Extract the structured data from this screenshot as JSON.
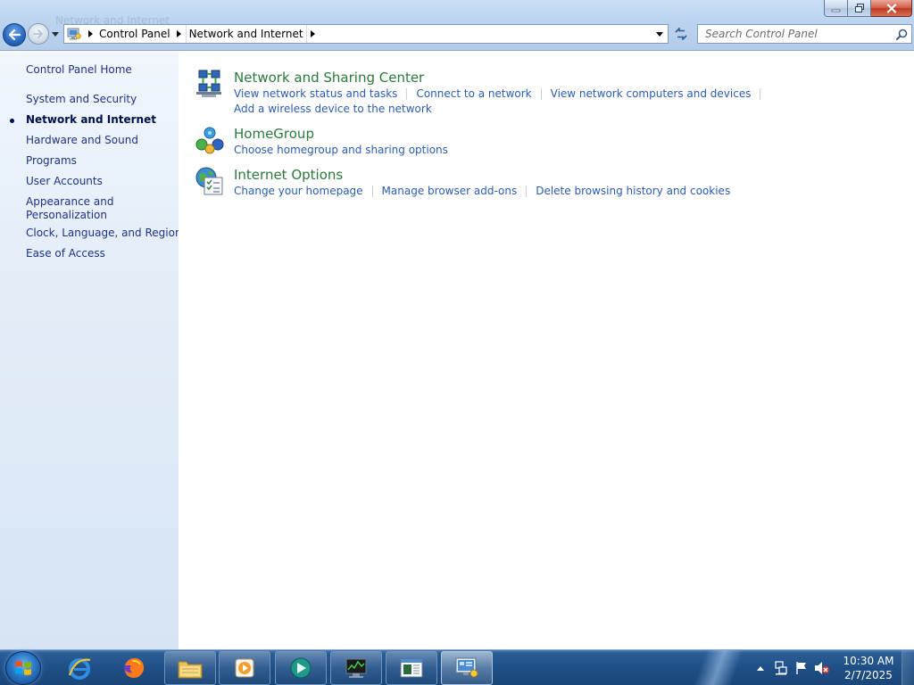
{
  "window": {
    "caption": "Network and Internet",
    "minimize_label": "Minimize",
    "maximize_label": "Maximize",
    "close_label": "Close"
  },
  "address": {
    "crumbs": [
      "Control Panel",
      "Network and Internet"
    ]
  },
  "search": {
    "placeholder": "Search Control Panel"
  },
  "left_pane": {
    "home": "Control Panel Home",
    "items": [
      {
        "label": "System and Security",
        "current": false
      },
      {
        "label": "Network and Internet",
        "current": true
      },
      {
        "label": "Hardware and Sound",
        "current": false
      },
      {
        "label": "Programs",
        "current": false
      },
      {
        "label": "User Accounts",
        "current": false
      },
      {
        "label": "Appearance and Personalization",
        "lines": [
          "Appearance and",
          "Personalization"
        ],
        "current": false
      },
      {
        "label": "Clock, Language, and Region",
        "current": false
      },
      {
        "label": "Ease of Access",
        "current": false
      }
    ]
  },
  "categories": [
    {
      "title": "Network and Sharing Center",
      "icon": "network-sharing-center-icon",
      "links": [
        [
          "View network status and tasks",
          "Connect to a network",
          "View network computers and devices"
        ],
        [
          "Add a wireless device to the network"
        ]
      ]
    },
    {
      "title": "HomeGroup",
      "icon": "homegroup-icon",
      "links": [
        [
          "Choose homegroup and sharing options"
        ]
      ]
    },
    {
      "title": "Internet Options",
      "icon": "internet-options-icon",
      "links": [
        [
          "Change your homepage",
          "Manage browser add-ons",
          "Delete browsing history and cookies"
        ]
      ]
    }
  ],
  "taskbar": {
    "items": [
      "internet-explorer-icon",
      "firefox-icon",
      "file-explorer-icon",
      "media-player-icon",
      "app-icon",
      "task-manager-icon",
      "document-viewer-icon",
      "control-panel-icon"
    ],
    "clock": {
      "time": "10:30 AM",
      "date": "2/7/2025"
    }
  },
  "colors": {
    "link": "#2a5cb3",
    "category_title": "#2b7a3b",
    "left_link": "#1e3287"
  }
}
